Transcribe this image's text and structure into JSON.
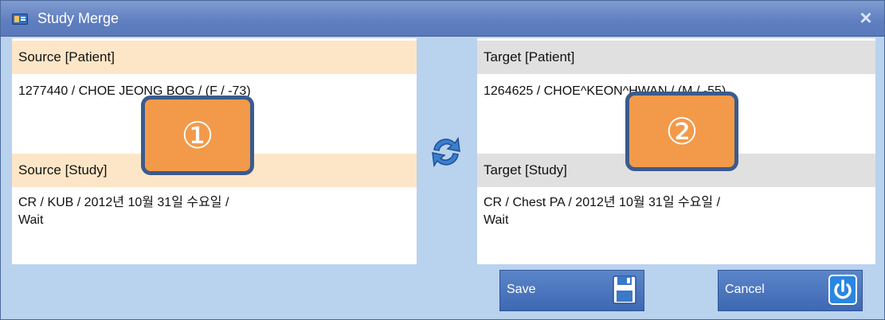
{
  "window": {
    "title": "Study Merge"
  },
  "source": {
    "patient_header": "Source [Patient]",
    "patient_value": "1277440 / CHOE JEONG BOG / (F / -73)",
    "study_header": "Source [Study]",
    "study_value": "CR / KUB / 2012년 10월 31일 수요일 /\nWait"
  },
  "target": {
    "patient_header": "Target [Patient]",
    "patient_value": "1264625 / CHOE^KEON^HWAN / (M / -55)",
    "study_header": "Target [Study]",
    "study_value": "CR / Chest PA / 2012년 10월 31일 수요일 /\nWait"
  },
  "callouts": [
    "①",
    "②"
  ],
  "buttons": {
    "save_label": "Save",
    "cancel_label": "Cancel"
  },
  "icons": {
    "app": "study-merge-app-icon",
    "close": "close-icon",
    "swap": "swap-arrows-icon",
    "save": "floppy-disk-icon",
    "cancel": "power-icon"
  },
  "colors": {
    "titlebar": "#6382c3",
    "source_header": "#fde6c7",
    "target_header": "#e0e0e0",
    "callout": "#f39a4a",
    "button": "#4a74bd"
  }
}
